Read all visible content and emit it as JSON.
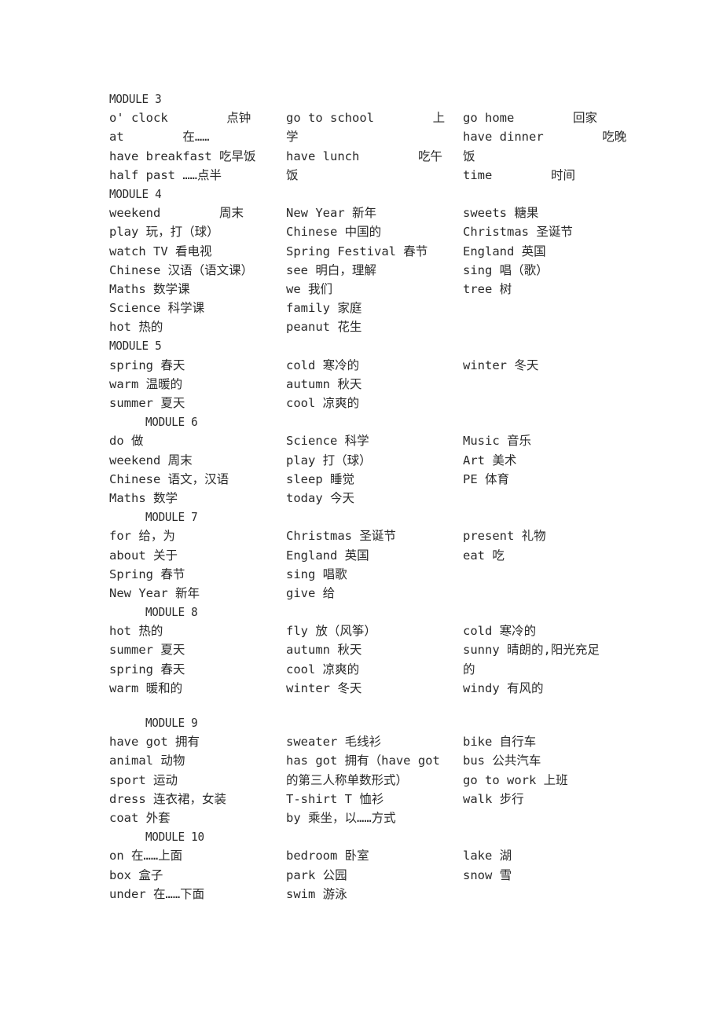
{
  "modules": [
    {
      "title": "MODULE 3",
      "rows": [
        [
          "o' clock        点钟",
          "go to school        上",
          "go home        回家"
        ],
        [
          "at        在……",
          "学",
          "have dinner        吃晚"
        ],
        [
          "have breakfast 吃早饭",
          "have lunch        吃午",
          "饭"
        ],
        [
          "half past ……点半",
          "饭",
          "time        时间"
        ]
      ]
    },
    {
      "title": "MODULE 4",
      "rows": [
        [
          "weekend        周末",
          "New Year 新年",
          "sweets 糖果"
        ],
        [
          "play 玩，打（球）",
          "Chinese 中国的",
          "Christmas 圣诞节"
        ],
        [
          "watch TV 看电视",
          "Spring Festival 春节",
          "England 英国"
        ],
        [
          "Chinese 汉语（语文课）",
          "see 明白，理解",
          "sing 唱（歌）"
        ],
        [
          "Maths 数学课",
          "we 我们",
          "tree 树"
        ],
        [
          "Science 科学课",
          "family 家庭",
          ""
        ],
        [
          "hot 热的",
          "peanut 花生",
          ""
        ]
      ]
    },
    {
      "title": "MODULE 5",
      "rows": [
        [
          "spring 春天",
          "cold 寒冷的",
          "winter 冬天"
        ],
        [
          "warm 温暖的",
          "autumn 秋天",
          ""
        ],
        [
          "summer 夏天",
          "cool 凉爽的",
          ""
        ]
      ]
    },
    {
      "title": "MODULE 6",
      "rows": [
        [
          "do 做",
          "Science 科学",
          "Music 音乐"
        ],
        [
          "weekend 周末",
          "play 打（球）",
          "Art 美术"
        ],
        [
          "Chinese 语文，汉语",
          "sleep 睡觉",
          "PE 体育"
        ],
        [
          "Maths 数学",
          "today 今天",
          ""
        ]
      ]
    },
    {
      "title": "MODULE 7",
      "rows": [
        [
          "for 给，为",
          "Christmas 圣诞节",
          "present 礼物"
        ],
        [
          "about 关于",
          "England 英国",
          "eat 吃"
        ],
        [
          "Spring 春节",
          "sing 唱歌",
          ""
        ],
        [
          "New Year 新年",
          "give 给",
          ""
        ]
      ]
    },
    {
      "title": "MODULE 8",
      "rows": [
        [
          "hot 热的",
          "fly 放（风筝）",
          "cold 寒冷的"
        ],
        [
          "summer 夏天",
          "autumn 秋天",
          "sunny 晴朗的,阳光充足"
        ],
        [
          "spring 春天",
          "cool 凉爽的",
          "的"
        ],
        [
          "warm 暖和的",
          "winter 冬天",
          "windy 有风的"
        ]
      ]
    },
    {
      "title": "MODULE 9",
      "rows": [
        [
          "have got 拥有",
          "sweater 毛线衫",
          "bike 自行车"
        ],
        [
          "animal 动物",
          "has got 拥有（have got",
          "bus 公共汽车"
        ],
        [
          "sport 运动",
          "的第三人称单数形式）",
          "go to work 上班"
        ],
        [
          "dress 连衣裙，女装",
          "T-shirt T 恤衫",
          "walk 步行"
        ],
        [
          "coat 外套",
          "by 乘坐，以……方式",
          ""
        ]
      ]
    },
    {
      "title": "MODULE 10",
      "rows": [
        [
          "on 在……上面",
          "bedroom 卧室",
          "lake 湖"
        ],
        [
          "box 盒子",
          "park 公园",
          "snow 雪"
        ],
        [
          "under 在……下面",
          "swim 游泳",
          ""
        ]
      ]
    }
  ]
}
